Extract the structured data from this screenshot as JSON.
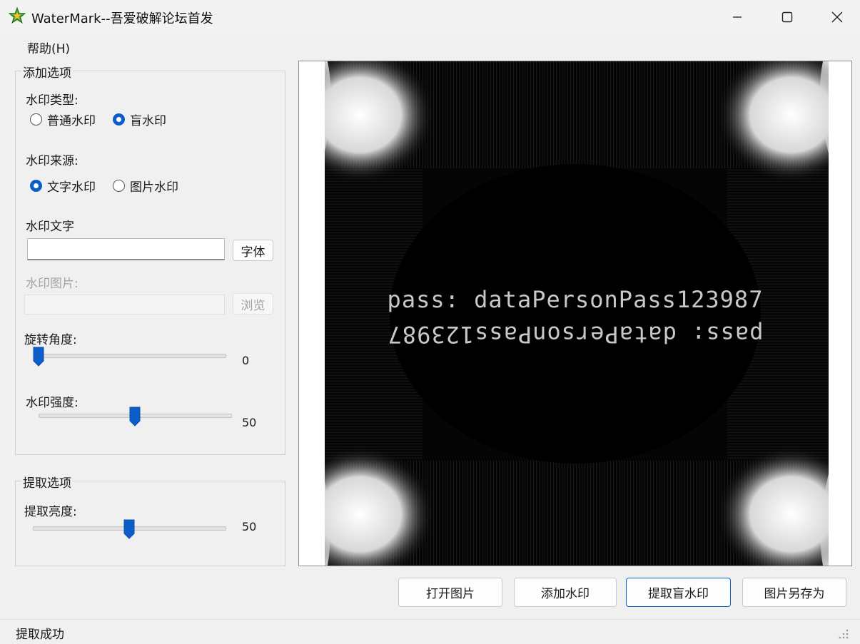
{
  "window": {
    "title": "WaterMark--吾爱破解论坛首发",
    "icon": "star-icon",
    "accent": "#0b5ec9"
  },
  "menu": {
    "help": "帮助(H)"
  },
  "add_options": {
    "title": "添加选项",
    "type_label": "水印类型:",
    "type_options": [
      "普通水印",
      "盲水印"
    ],
    "type_selected": "盲水印",
    "source_label": "水印来源:",
    "source_options": [
      "文字水印",
      "图片水印"
    ],
    "source_selected": "文字水印",
    "text_label": "水印文字",
    "text_value": "",
    "font_button": "字体",
    "image_label": "水印图片:",
    "image_value": "",
    "browse_button": "浏览",
    "rotation_label": "旋转角度:",
    "rotation_value": "0",
    "rotation_fraction": 0.0,
    "strength_label": "水印强度:",
    "strength_value": "50",
    "strength_fraction": 0.5
  },
  "extract_options": {
    "title": "提取选项",
    "brightness_label": "提取亮度:",
    "brightness_value": "50",
    "brightness_fraction": 0.5
  },
  "preview": {
    "line1": "pass: dataPersonPass123987",
    "line2": "pass: dataPersonPass123987"
  },
  "buttons": {
    "open": "打开图片",
    "add": "添加水印",
    "extract": "提取盲水印",
    "save_as": "图片另存为"
  },
  "status": {
    "text": "提取成功"
  }
}
